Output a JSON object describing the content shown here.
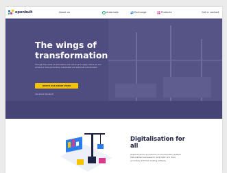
{
  "header": {
    "logo_text": "openbult",
    "about": "About us",
    "nav": [
      {
        "label": "Automate",
        "icon": "automate-icon",
        "color": "#1fa971"
      },
      {
        "label": "Exchange",
        "icon": "exchange-icon",
        "color": "#2b7de9"
      },
      {
        "label": "Products",
        "icon": "products-icon",
        "color": "#d63b8f"
      }
    ],
    "right_link": "Get in contact"
  },
  "hero": {
    "title": "The wings of transformation",
    "description": "Through the power of automation and end-to-end supply chains we can achieve a more productive, sustainable and safe built environment.",
    "cta": "Watch our short video",
    "link": "Ask about Openbult",
    "background_color": "#4f4c80",
    "cta_color": "#f5c400"
  },
  "section": {
    "title": "Digitalisation for all",
    "text": "Openbult will be a production and automation platform that enables businesses to work faster and more accurately with their existing software."
  },
  "colors": {
    "brand_dark": "#1d2142",
    "accent_yellow": "#f5c400"
  }
}
